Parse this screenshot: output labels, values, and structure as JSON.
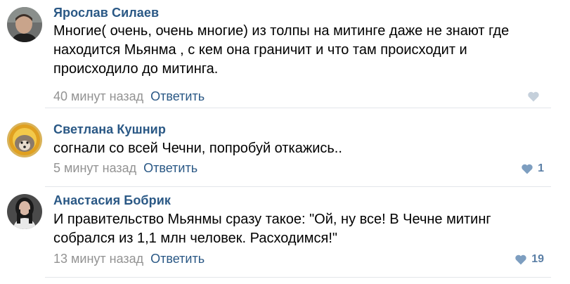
{
  "comments": [
    {
      "author": "Ярослав Силаев",
      "lines": [
        "Многие( очень, очень многие) из толпы на митинге даже не знают где",
        "находится Мьянма , с кем она граничит и что там происходит и",
        "происходило до митинга."
      ],
      "time": "40 минут назад",
      "reply": "Ответить",
      "likes": ""
    },
    {
      "author": "Светлана Кушнир",
      "lines": [
        "согнали со всей Чечни, попробуй откажись.."
      ],
      "time": "5 минут назад",
      "reply": "Ответить",
      "likes": "1"
    },
    {
      "author": "Анастасия Бобрик",
      "lines": [
        "И правительство Мьянмы сразу такое: \"Ой, ну все! В Чечне митинг",
        "собрался из 1,1 млн человек. Расходимся!\""
      ],
      "time": "13 минут назад",
      "reply": "Ответить",
      "likes": "19"
    }
  ],
  "icons": {
    "like": "heart-icon"
  },
  "colors": {
    "link": "#2a5885",
    "muted": "#939393",
    "like_active": "#7d9ec0",
    "like_inactive": "#c5d0db"
  }
}
